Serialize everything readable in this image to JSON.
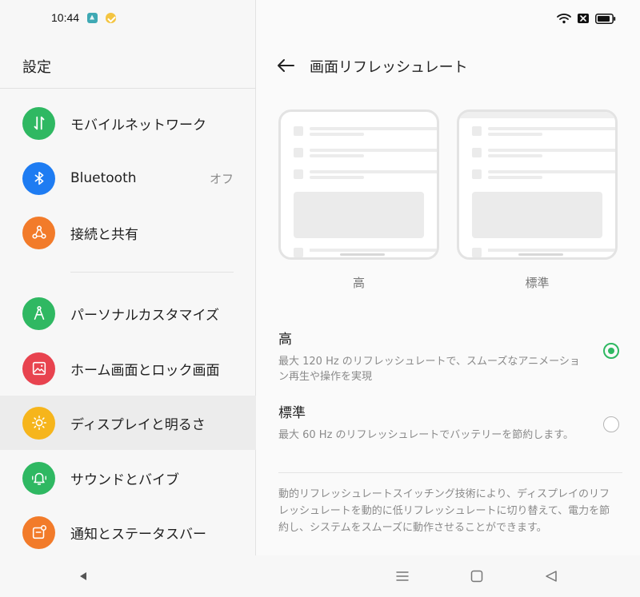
{
  "status": {
    "time": "10:44"
  },
  "left": {
    "title": "設定",
    "items": [
      {
        "label": "モバイルネットワーク",
        "color": "#2fb862"
      },
      {
        "label": "Bluetooth",
        "value": "オフ",
        "color": "#1e7cf2"
      },
      {
        "label": "接続と共有",
        "color": "#f27b2a"
      },
      {
        "label": "パーソナルカスタマイズ",
        "color": "#2fb862"
      },
      {
        "label": "ホーム画面とロック画面",
        "color": "#e8434f"
      },
      {
        "label": "ディスプレイと明るさ",
        "color": "#f6b51c"
      },
      {
        "label": "サウンドとバイブ",
        "color": "#2fb862"
      },
      {
        "label": "通知とステータスバー",
        "color": "#f27b2a"
      }
    ]
  },
  "right": {
    "title": "画面リフレッシュレート",
    "preview_high_label": "高",
    "preview_std_label": "標準",
    "options": [
      {
        "title": "高",
        "desc": "最大 120 Hz のリフレッシュレートで、スムーズなアニメーション再生や操作を実現",
        "selected": true
      },
      {
        "title": "標準",
        "desc": "最大 60 Hz のリフレッシュレートでバッテリーを節約します。",
        "selected": false
      }
    ],
    "footnote": "動的リフレッシュレートスイッチング技術により、ディスプレイのリフレッシュレートを動的に低リフレッシュレートに切り替えて、電力を節約し、システムをスムーズに動作させることができます。"
  },
  "accent": "#2fb862"
}
